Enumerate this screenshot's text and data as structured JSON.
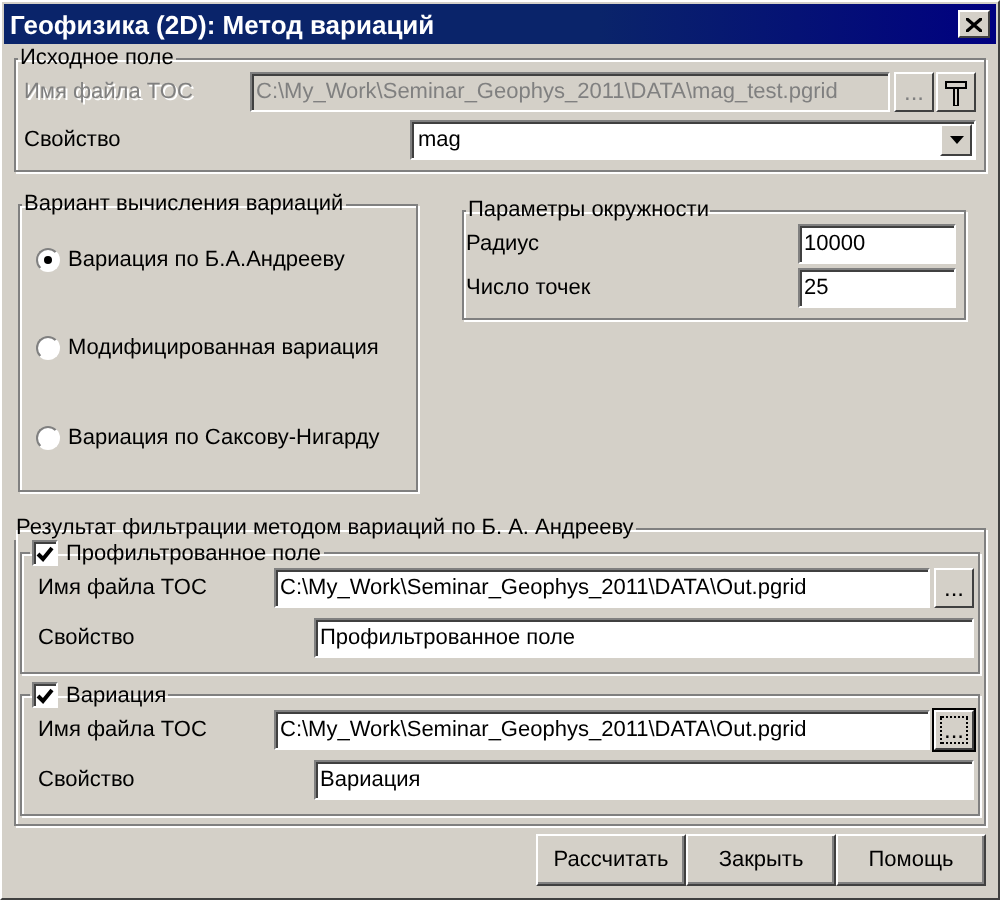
{
  "window": {
    "title": "Геофизика (2D): Метод вариаций"
  },
  "source": {
    "title": "Исходное поле",
    "disabled": true,
    "file_label": "Имя файла TOC",
    "file_value": "C:\\My_Work\\Seminar_Geophys_2011\\DATA\\mag_test.pgrid",
    "browse": "...",
    "property_label": "Свойство",
    "property_value": "mag"
  },
  "variant": {
    "title": "Вариант вычисления вариаций",
    "options": [
      {
        "label": "Вариация по Б.А.Андрееву",
        "selected": true
      },
      {
        "label": "Модифицированная вариация",
        "selected": false
      },
      {
        "label": "Вариация по Саксову-Нигарду",
        "selected": false
      }
    ]
  },
  "circle": {
    "title": "Параметры окружности",
    "fields": [
      {
        "label": "Радиус",
        "value": "10000"
      },
      {
        "label": "Число точек",
        "value": "25"
      }
    ]
  },
  "result": {
    "title": "Результат фильтрации методом вариаций по Б. А. Андрееву",
    "outputs": [
      {
        "title": "Профильтрованное поле",
        "checked": true,
        "file_label": "Имя файла TOC",
        "file_value": "C:\\My_Work\\Seminar_Geophys_2011\\DATA\\Out.pgrid",
        "browse": "...",
        "focused": false,
        "property_label": "Свойство",
        "property_value": "Профильтрованное поле"
      },
      {
        "title": "Вариация",
        "checked": true,
        "file_label": "Имя файла TOC",
        "file_value": "C:\\My_Work\\Seminar_Geophys_2011\\DATA\\Out.pgrid",
        "browse": "...",
        "focused": true,
        "property_label": "Свойство",
        "property_value": "Вариация"
      }
    ]
  },
  "buttons": [
    "Рассчитать",
    "Закрыть",
    "Помощь"
  ]
}
